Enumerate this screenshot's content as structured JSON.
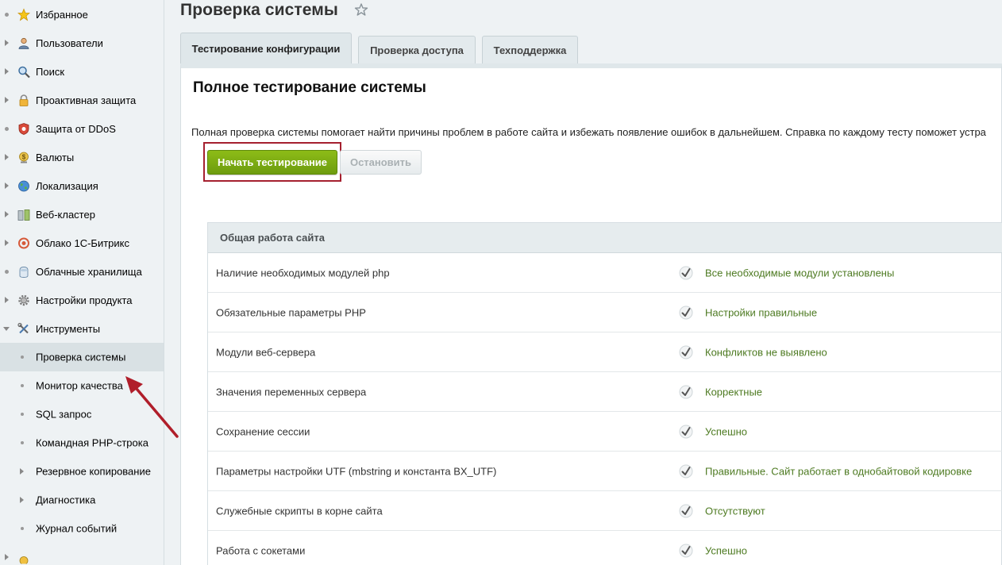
{
  "sidebar": {
    "items": [
      {
        "label": "Избранное",
        "toggle": "dot",
        "icon": "star-icon"
      },
      {
        "label": "Пользователи",
        "toggle": "arrow",
        "icon": "user-icon"
      },
      {
        "label": "Поиск",
        "toggle": "arrow",
        "icon": "magnifier-icon"
      },
      {
        "label": "Проактивная защита",
        "toggle": "arrow",
        "icon": "lock-icon"
      },
      {
        "label": "Защита от DDoS",
        "toggle": "dot",
        "icon": "shield-icon"
      },
      {
        "label": "Валюты",
        "toggle": "arrow",
        "icon": "currency-icon"
      },
      {
        "label": "Локализация",
        "toggle": "arrow",
        "icon": "globe-icon"
      },
      {
        "label": "Веб-кластер",
        "toggle": "arrow",
        "icon": "cluster-icon"
      },
      {
        "label": "Облако 1С-Битрикс",
        "toggle": "arrow",
        "icon": "cloud-icon"
      },
      {
        "label": "Облачные хранилища",
        "toggle": "dot",
        "icon": "storage-icon"
      },
      {
        "label": "Настройки продукта",
        "toggle": "arrow",
        "icon": "gear-icon"
      },
      {
        "label": "Инструменты",
        "toggle": "expanded",
        "icon": "tools-icon"
      }
    ],
    "tools_subitems": [
      {
        "label": "Проверка системы",
        "toggle": "dot",
        "active": true
      },
      {
        "label": "Монитор качества",
        "toggle": "dot"
      },
      {
        "label": "SQL запрос",
        "toggle": "dot"
      },
      {
        "label": "Командная PHP-строка",
        "toggle": "dot"
      },
      {
        "label": "Резервное копирование",
        "toggle": "arrow"
      },
      {
        "label": "Диагностика",
        "toggle": "arrow"
      },
      {
        "label": "Журнал событий",
        "toggle": "dot"
      }
    ]
  },
  "header": {
    "title": "Проверка системы"
  },
  "tabs": [
    {
      "label": "Тестирование конфигурации",
      "active": true
    },
    {
      "label": "Проверка доступа",
      "active": false
    },
    {
      "label": "Техподдержка",
      "active": false
    }
  ],
  "main": {
    "heading": "Полное тестирование системы",
    "description": "Полная проверка системы помогает найти причины проблем в работе сайта и избежать появление ошибок в дальнейшем. Справка по каждому тесту поможет устра",
    "start_button": "Начать тестирование",
    "stop_button": "Остановить"
  },
  "table": {
    "header": "Общая работа сайта",
    "rows": [
      {
        "name": "Наличие необходимых модулей php",
        "result": "Все необходимые модули установлены"
      },
      {
        "name": "Обязательные параметры PHP",
        "result": "Настройки правильные"
      },
      {
        "name": "Модули веб-сервера",
        "result": "Конфликтов не выявлено"
      },
      {
        "name": "Значения переменных сервера",
        "result": "Корректные"
      },
      {
        "name": "Сохранение сессии",
        "result": "Успешно"
      },
      {
        "name": "Параметры настройки UTF (mbstring и константа BX_UTF)",
        "result": "Правильные. Сайт работает в однобайтовой кодировке"
      },
      {
        "name": "Служебные скрипты в корне сайта",
        "result": "Отсутствуют"
      },
      {
        "name": "Работа с сокетами",
        "result": "Успешно"
      }
    ]
  },
  "colors": {
    "accent_green": "#7aad14",
    "result_green": "#4d7a21",
    "highlight_red": "#a5202f"
  }
}
